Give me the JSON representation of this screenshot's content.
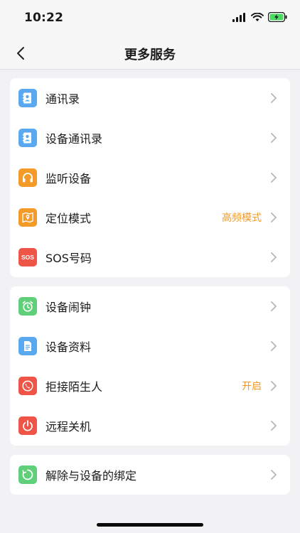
{
  "status_bar": {
    "time": "10:22"
  },
  "nav": {
    "title": "更多服务"
  },
  "colors": {
    "accent": "#f09a2b",
    "blue": "#5aa8f0",
    "orange": "#f39a29",
    "red": "#ee5548",
    "green": "#5fcf7a"
  },
  "groups": [
    {
      "items": [
        {
          "label": "通讯录",
          "icon": "contacts-icon"
        },
        {
          "label": "设备通讯录",
          "icon": "device-contacts-icon"
        },
        {
          "label": "监听设备",
          "icon": "headphones-icon"
        },
        {
          "label": "定位模式",
          "icon": "map-icon",
          "value": "高频模式"
        },
        {
          "label": "SOS号码",
          "icon": "sos-icon",
          "icon_text": "SOS"
        }
      ]
    },
    {
      "items": [
        {
          "label": "设备闹钟",
          "icon": "alarm-icon"
        },
        {
          "label": "设备资料",
          "icon": "document-icon"
        },
        {
          "label": "拒接陌生人",
          "icon": "phone-block-icon",
          "value": "开启"
        },
        {
          "label": "远程关机",
          "icon": "power-icon"
        }
      ]
    },
    {
      "items": [
        {
          "label": "解除与设备的绑定",
          "icon": "unbind-icon"
        }
      ]
    }
  ]
}
